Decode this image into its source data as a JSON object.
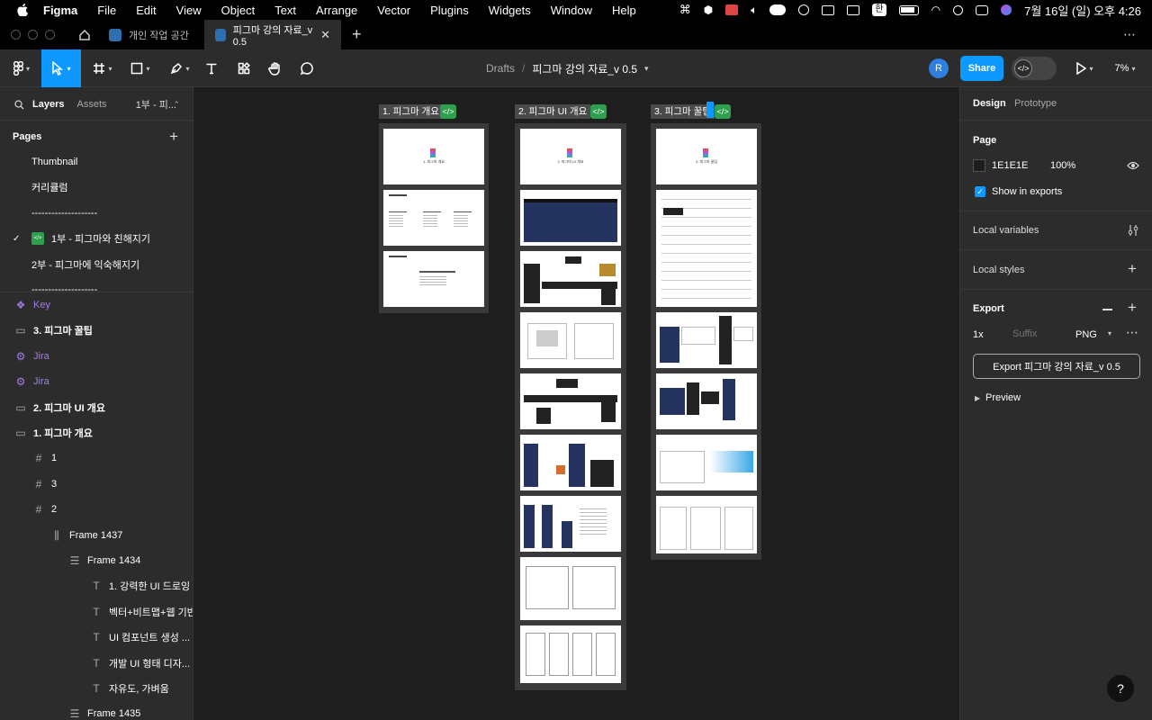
{
  "menubar": {
    "app": "Figma",
    "items": [
      "File",
      "Edit",
      "View",
      "Object",
      "Text",
      "Arrange",
      "Vector",
      "Plugins",
      "Widgets",
      "Window",
      "Help"
    ],
    "datetime": "7월 16일 (일) 오후 4:26",
    "input_mode": "한"
  },
  "tabs": [
    {
      "label": "개인 작업 공간",
      "active": false
    },
    {
      "label": "피그마 강의 자료_v 0.5",
      "active": true
    }
  ],
  "toolbar": {
    "breadcrumb_root": "Drafts",
    "separator": "/",
    "file_name": "피그마 강의 자료_v 0.5",
    "avatar": "R",
    "share_label": "Share",
    "zoom": "7%"
  },
  "left": {
    "tab_layers": "Layers",
    "tab_assets": "Assets",
    "current_page_short": "1부 - 피...",
    "pages_title": "Pages",
    "pages": [
      {
        "label": "Thumbnail",
        "current": false
      },
      {
        "label": "커리큘럼",
        "current": false
      },
      {
        "label": "--------------------",
        "current": false
      },
      {
        "label": "1부 - 피그마와 친해지기",
        "current": true
      },
      {
        "label": "2부 - 피그마에 익숙해지기",
        "current": false
      },
      {
        "label": "--------------------",
        "current": false
      }
    ],
    "layers": [
      {
        "label": "Key",
        "icon": "component-icon",
        "indent": 0,
        "color": "purple"
      },
      {
        "label": "3. 피그마 꿀팁",
        "icon": "section-icon",
        "indent": 0,
        "color": "white"
      },
      {
        "label": "Jira",
        "icon": "widget-icon",
        "indent": 0,
        "color": "purple"
      },
      {
        "label": "Jira",
        "icon": "widget-icon",
        "indent": 0,
        "color": "purple"
      },
      {
        "label": "2. 피그마 UI 개요",
        "icon": "section-icon",
        "indent": 0,
        "color": "white"
      },
      {
        "label": "1. 피그마 개요",
        "icon": "section-icon",
        "indent": 0,
        "color": "white"
      },
      {
        "label": "1",
        "icon": "frame-icon",
        "indent": 1,
        "color": "white"
      },
      {
        "label": "3",
        "icon": "frame-icon",
        "indent": 1,
        "color": "white"
      },
      {
        "label": "2",
        "icon": "frame-icon",
        "indent": 1,
        "color": "white"
      },
      {
        "label": "Frame 1437",
        "icon": "autolayout-h-icon",
        "indent": 2,
        "color": "white"
      },
      {
        "label": "Frame 1434",
        "icon": "autolayout-v-icon",
        "indent": 3,
        "color": "white"
      },
      {
        "label": "1. 강력한 UI 드로잉",
        "icon": "text-icon",
        "indent": 4,
        "color": "white"
      },
      {
        "label": "벡터+비트맵+웹 기반",
        "icon": "text-icon",
        "indent": 4,
        "color": "white"
      },
      {
        "label": "UI 컴포넌트 생성 ...",
        "icon": "text-icon",
        "indent": 4,
        "color": "white"
      },
      {
        "label": "개발 UI 형태 디자...",
        "icon": "text-icon",
        "indent": 4,
        "color": "white"
      },
      {
        "label": "자유도, 가벼움",
        "icon": "text-icon",
        "indent": 4,
        "color": "white"
      },
      {
        "label": "Frame 1435",
        "icon": "autolayout-v-icon",
        "indent": 3,
        "color": "white"
      }
    ]
  },
  "canvas": {
    "sections": [
      {
        "label": "1. 피그마 개요"
      },
      {
        "label": "2. 피그마 UI 개요"
      },
      {
        "label": "3. 피그마 꿀팁"
      }
    ],
    "slide_titles": [
      "1. 피그마 개요",
      "2. 피그마 UI 개요",
      "3. 피그마 꿀팁"
    ]
  },
  "right": {
    "tab_design": "Design",
    "tab_prototype": "Prototype",
    "page_title": "Page",
    "page_color": "1E1E1E",
    "page_opacity": "100%",
    "show_in_exports": "Show in exports",
    "local_variables": "Local variables",
    "local_styles": "Local styles",
    "export_title": "Export",
    "export_scale": "1x",
    "export_suffix_placeholder": "Suffix",
    "export_format": "PNG",
    "export_button": "Export 피그마 강의 자료_v 0.5",
    "preview": "Preview",
    "help": "?"
  },
  "colors": {
    "accent": "#0d99ff",
    "panel": "#2c2c2c",
    "canvas": "#1e1e1e",
    "component_purple": "#a27ce8",
    "dev_green": "#2e9f4f"
  }
}
